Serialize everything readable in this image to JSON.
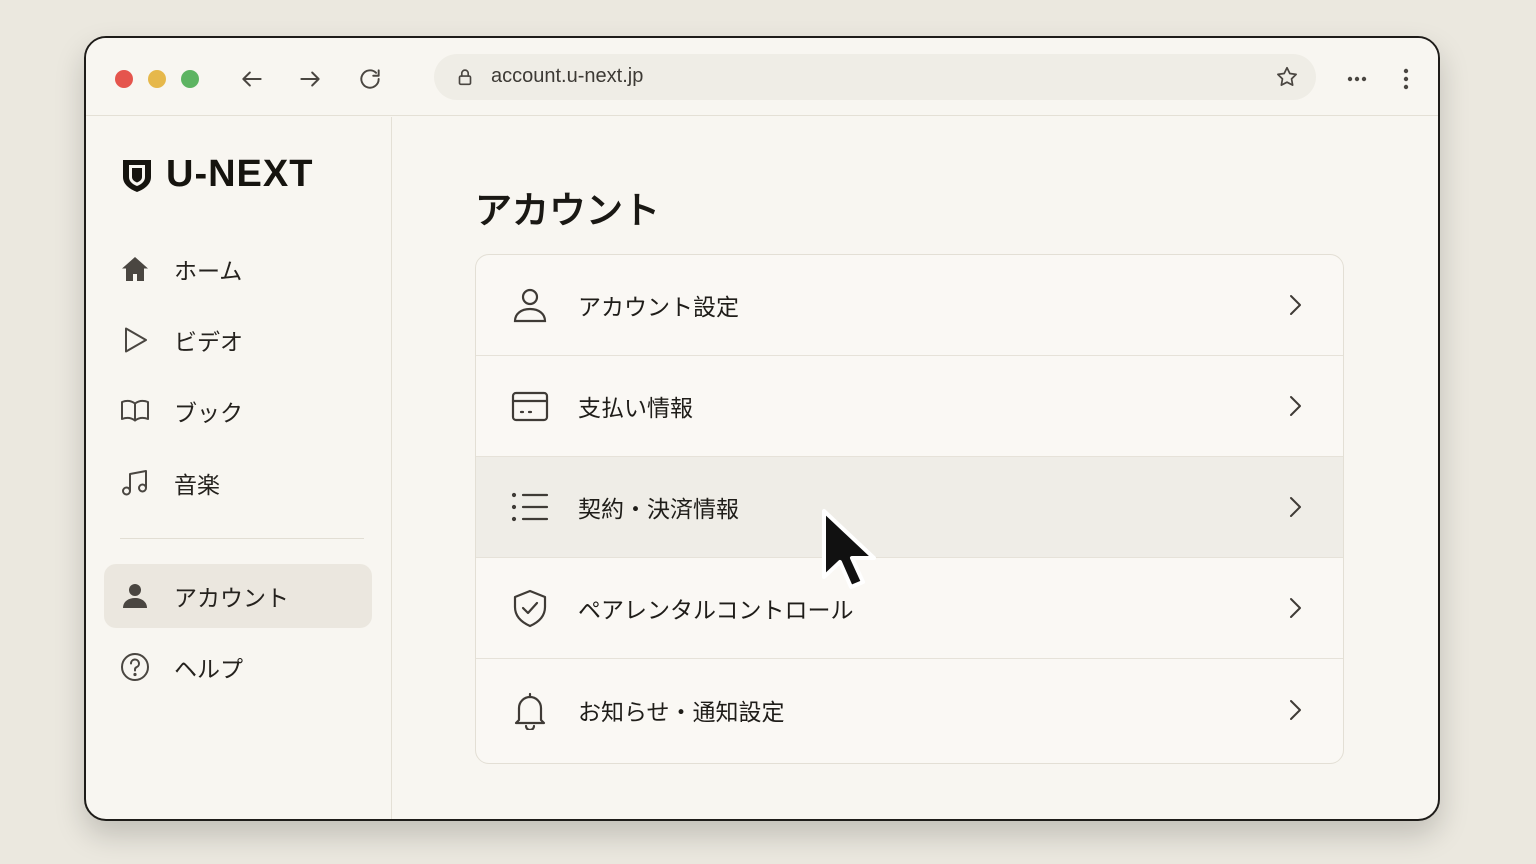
{
  "browser": {
    "url": "account.u-next.jp",
    "icons": {
      "back": "arrow-left-icon",
      "forward": "arrow-right-icon",
      "reload": "reload-icon",
      "lock": "lock-icon",
      "bookmark": "star-icon",
      "extensions": "more-horizontal-icon",
      "menu": "more-vertical-icon"
    }
  },
  "sidebar": {
    "logo_text": "U-NEXT",
    "items": [
      {
        "label": "ホーム",
        "icon": "home-icon",
        "active": false
      },
      {
        "label": "ビデオ",
        "icon": "play-icon",
        "active": false
      },
      {
        "label": "ブック",
        "icon": "book-icon",
        "active": false
      },
      {
        "label": "音楽",
        "icon": "music-icon",
        "active": false
      },
      {
        "label": "アカウント",
        "icon": "user-icon",
        "active": true
      },
      {
        "label": "ヘルプ",
        "icon": "help-icon",
        "active": false
      }
    ]
  },
  "main": {
    "title": "アカウント",
    "rows": [
      {
        "label": "アカウント設定",
        "icon": "user-outline-icon"
      },
      {
        "label": "支払い情報",
        "icon": "credit-card-icon"
      },
      {
        "label": "契約・決済情報",
        "icon": "list-icon",
        "hovered": true
      },
      {
        "label": "ペアレンタルコントロール",
        "icon": "shield-check-icon"
      },
      {
        "label": "お知らせ・通知設定",
        "icon": "bell-icon"
      }
    ]
  },
  "colors": {
    "background": "#ebe8df",
    "window": "#f8f6f1",
    "active_item": "#ebe7df",
    "hover_row": "#efede7",
    "traffic_red": "#e5554d",
    "traffic_yellow": "#e6b84b",
    "traffic_green": "#5db462"
  }
}
